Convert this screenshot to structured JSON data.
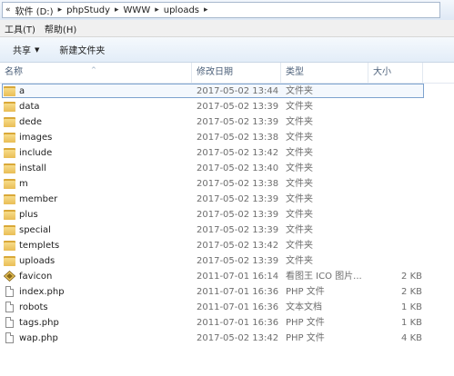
{
  "address": {
    "crumbs": [
      "软件 (D:)",
      "phpStudy",
      "WWW",
      "uploads"
    ]
  },
  "menu": {
    "tools": "工具(T)",
    "help": "帮助(H)"
  },
  "toolbar": {
    "share": "共享",
    "new_folder": "新建文件夹"
  },
  "columns": {
    "name": "名称",
    "date": "修改日期",
    "type": "类型",
    "size": "大小"
  },
  "files": [
    {
      "name": "a",
      "date": "2017-05-02 13:44",
      "type": "文件夹",
      "size": "",
      "icon": "folder-icon"
    },
    {
      "name": "data",
      "date": "2017-05-02 13:39",
      "type": "文件夹",
      "size": "",
      "icon": "folder-icon"
    },
    {
      "name": "dede",
      "date": "2017-05-02 13:39",
      "type": "文件夹",
      "size": "",
      "icon": "folder-icon"
    },
    {
      "name": "images",
      "date": "2017-05-02 13:38",
      "type": "文件夹",
      "size": "",
      "icon": "folder-icon"
    },
    {
      "name": "include",
      "date": "2017-05-02 13:42",
      "type": "文件夹",
      "size": "",
      "icon": "folder-icon"
    },
    {
      "name": "install",
      "date": "2017-05-02 13:40",
      "type": "文件夹",
      "size": "",
      "icon": "folder-icon"
    },
    {
      "name": "m",
      "date": "2017-05-02 13:38",
      "type": "文件夹",
      "size": "",
      "icon": "folder-icon"
    },
    {
      "name": "member",
      "date": "2017-05-02 13:39",
      "type": "文件夹",
      "size": "",
      "icon": "folder-icon"
    },
    {
      "name": "plus",
      "date": "2017-05-02 13:39",
      "type": "文件夹",
      "size": "",
      "icon": "folder-icon"
    },
    {
      "name": "special",
      "date": "2017-05-02 13:39",
      "type": "文件夹",
      "size": "",
      "icon": "folder-icon"
    },
    {
      "name": "templets",
      "date": "2017-05-02 13:42",
      "type": "文件夹",
      "size": "",
      "icon": "folder-icon"
    },
    {
      "name": "uploads",
      "date": "2017-05-02 13:39",
      "type": "文件夹",
      "size": "",
      "icon": "folder-icon"
    },
    {
      "name": "favicon",
      "date": "2011-07-01 16:14",
      "type": "看图王 ICO 图片...",
      "size": "2 KB",
      "icon": "ico-image-icon"
    },
    {
      "name": "index.php",
      "date": "2011-07-01 16:36",
      "type": "PHP 文件",
      "size": "2 KB",
      "icon": "php-file-icon"
    },
    {
      "name": "robots",
      "date": "2011-07-01 16:36",
      "type": "文本文档",
      "size": "1 KB",
      "icon": "text-file-icon"
    },
    {
      "name": "tags.php",
      "date": "2011-07-01 16:36",
      "type": "PHP 文件",
      "size": "1 KB",
      "icon": "php-file-icon"
    },
    {
      "name": "wap.php",
      "date": "2017-05-02 13:42",
      "type": "PHP 文件",
      "size": "4 KB",
      "icon": "php-file-icon"
    }
  ]
}
